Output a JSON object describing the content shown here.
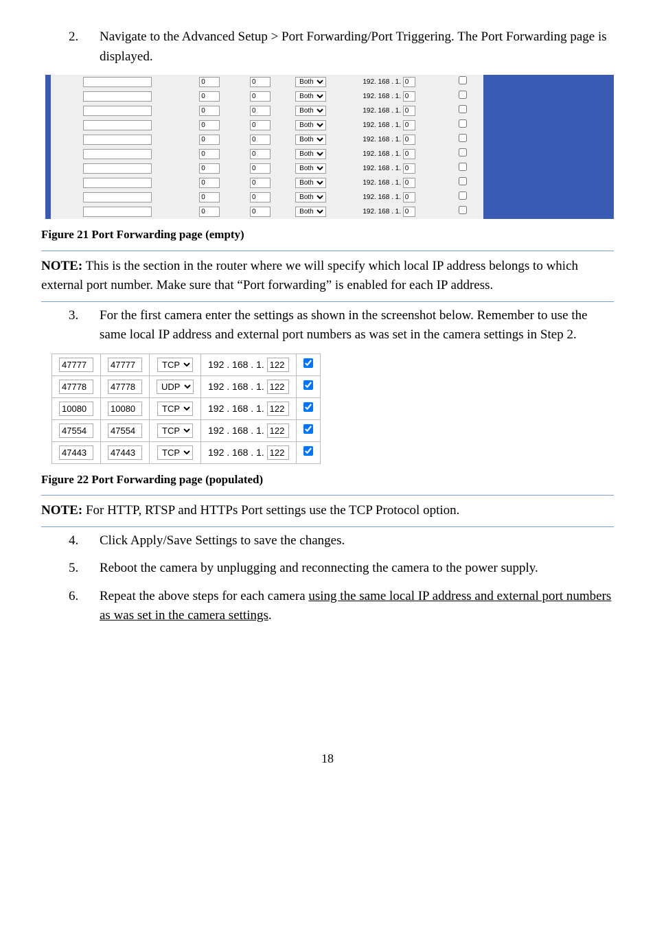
{
  "step2": {
    "num": "2.",
    "text": "Navigate to the Advanced Setup > Port Forwarding/Port Triggering. The Port Forwarding page is displayed."
  },
  "fig21": {
    "caption": "Figure 21 Port Forwarding page (empty)",
    "rows": [
      {
        "name": "",
        "p1": "0",
        "p2": "0",
        "proto": "Both",
        "ip1": "192",
        "ip2": "168",
        "ip3": "1",
        "ip4": "0",
        "checked": false
      },
      {
        "name": "",
        "p1": "0",
        "p2": "0",
        "proto": "Both",
        "ip1": "192",
        "ip2": "168",
        "ip3": "1",
        "ip4": "0",
        "checked": false
      },
      {
        "name": "",
        "p1": "0",
        "p2": "0",
        "proto": "Both",
        "ip1": "192",
        "ip2": "168",
        "ip3": "1",
        "ip4": "0",
        "checked": false
      },
      {
        "name": "",
        "p1": "0",
        "p2": "0",
        "proto": "Both",
        "ip1": "192",
        "ip2": "168",
        "ip3": "1",
        "ip4": "0",
        "checked": false
      },
      {
        "name": "",
        "p1": "0",
        "p2": "0",
        "proto": "Both",
        "ip1": "192",
        "ip2": "168",
        "ip3": "1",
        "ip4": "0",
        "checked": false
      },
      {
        "name": "",
        "p1": "0",
        "p2": "0",
        "proto": "Both",
        "ip1": "192",
        "ip2": "168",
        "ip3": "1",
        "ip4": "0",
        "checked": false
      },
      {
        "name": "",
        "p1": "0",
        "p2": "0",
        "proto": "Both",
        "ip1": "192",
        "ip2": "168",
        "ip3": "1",
        "ip4": "0",
        "checked": false
      },
      {
        "name": "",
        "p1": "0",
        "p2": "0",
        "proto": "Both",
        "ip1": "192",
        "ip2": "168",
        "ip3": "1",
        "ip4": "0",
        "checked": false
      },
      {
        "name": "",
        "p1": "0",
        "p2": "0",
        "proto": "Both",
        "ip1": "192",
        "ip2": "168",
        "ip3": "1",
        "ip4": "0",
        "checked": false
      },
      {
        "name": "",
        "p1": "0",
        "p2": "0",
        "proto": "Both",
        "ip1": "192",
        "ip2": "168",
        "ip3": "1",
        "ip4": "0",
        "checked": false
      }
    ]
  },
  "note1": {
    "label": "NOTE:",
    "text": " This is the section in the router where we will specify which local IP address belongs to which external port number. Make sure that “Port forwarding” is enabled for each IP address."
  },
  "step3": {
    "num": "3.",
    "text": "For the first camera enter the settings as shown in the screenshot below. Remember to use the same local IP address and external port numbers as was set in the camera settings in Step 2."
  },
  "fig22": {
    "caption": "Figure 22 Port Forwarding page (populated)",
    "rows": [
      {
        "p1": "47777",
        "p2": "47777",
        "proto": "TCP",
        "ip1": "192",
        "ip2": "168",
        "ip3": "1",
        "ip4": "122",
        "checked": true
      },
      {
        "p1": "47778",
        "p2": "47778",
        "proto": "UDP",
        "ip1": "192",
        "ip2": "168",
        "ip3": "1",
        "ip4": "122",
        "checked": true
      },
      {
        "p1": "10080",
        "p2": "10080",
        "proto": "TCP",
        "ip1": "192",
        "ip2": "168",
        "ip3": "1",
        "ip4": "122",
        "checked": true
      },
      {
        "p1": "47554",
        "p2": "47554",
        "proto": "TCP",
        "ip1": "192",
        "ip2": "168",
        "ip3": "1",
        "ip4": "122",
        "checked": true
      },
      {
        "p1": "47443",
        "p2": "47443",
        "proto": "TCP",
        "ip1": "192",
        "ip2": "168",
        "ip3": "1",
        "ip4": "122",
        "checked": true
      }
    ]
  },
  "note2": {
    "label": "NOTE:",
    "text": " For HTTP, RTSP and HTTPs Port settings use the TCP Protocol option."
  },
  "step4": {
    "num": "4.",
    "text": "Click Apply/Save Settings to save the changes."
  },
  "step5": {
    "num": "5.",
    "text": "Reboot the camera by unplugging and reconnecting the camera to the power supply."
  },
  "step6": {
    "num": "6.",
    "textA": "Repeat the above steps for each camera ",
    "textB": "using the same local IP address and external port numbers as was set in the camera settings",
    "textC": "."
  },
  "pageNumber": "18",
  "dot": " . "
}
